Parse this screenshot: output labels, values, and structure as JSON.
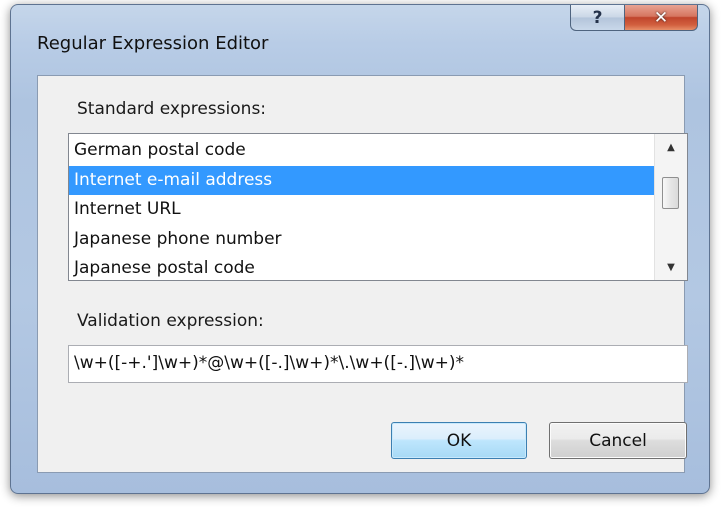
{
  "window": {
    "title": "Regular Expression Editor",
    "help_label": "?",
    "close_label": "✕"
  },
  "standard_expressions": {
    "label": "Standard expressions:",
    "items": [
      "German postal code",
      "Internet e-mail address",
      "Internet URL",
      "Japanese phone number",
      "Japanese postal code"
    ],
    "selected": "Internet e-mail address",
    "scroll_up_glyph": "▲",
    "scroll_down_glyph": "▼"
  },
  "validation": {
    "label": "Validation expression:",
    "value": "\\w+([-+.']\\w+)*@\\w+([-.]\\w+)*\\.\\w+([-.]\\w+)*"
  },
  "buttons": {
    "ok_label": "OK",
    "cancel_label": "Cancel"
  },
  "colors": {
    "selection": "#3399ff",
    "window_frame": "#b3c8e3",
    "close_button": "#c0452c"
  }
}
